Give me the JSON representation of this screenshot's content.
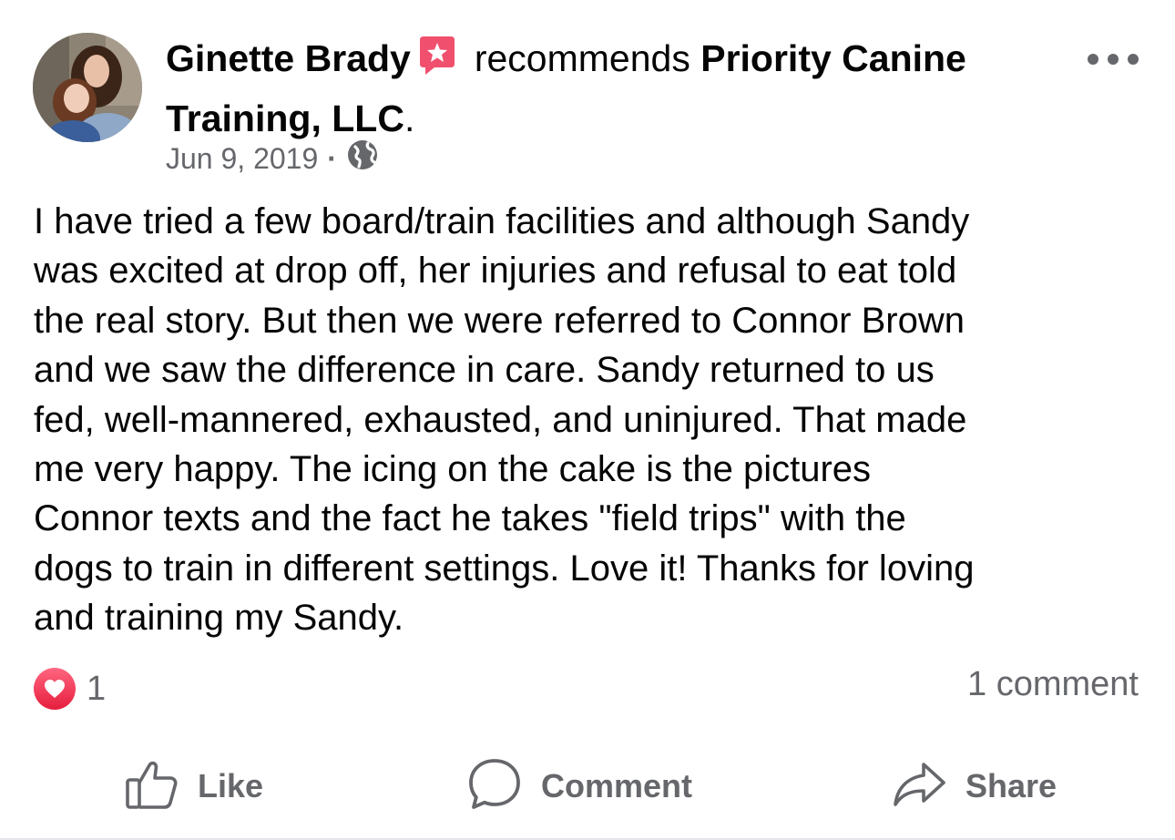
{
  "post": {
    "author": "Ginette Brady",
    "verb": "recommends",
    "page_name_line1": "Priority Canine",
    "page_name_line2": "Training, LLC",
    "page_name_period": ".",
    "date": "Jun 9, 2019",
    "separator": "·",
    "privacy_icon": "globe-icon",
    "badge_icon": "recommendation-star-icon",
    "more_icon": "ellipsis-icon",
    "text": "I have tried a few board/train facilities and although Sandy\nwas excited at drop off, her injuries and refusal to eat told\nthe real story. But then we were referred to Connor Brown\nand we saw the difference in care. Sandy returned to us\nfed, well-mannered, exhausted,  and uninjured. That made\nme very happy. The icing on the cake is the pictures\nConnor texts and the fact he takes \"field trips\" with the\ndogs to train in different settings. Love it! Thanks for loving\nand training my Sandy."
  },
  "stats": {
    "reaction_icon": "love-heart-icon",
    "reaction_count": "1",
    "comment_count": "1 comment"
  },
  "actions": {
    "like_label": "Like",
    "comment_label": "Comment",
    "share_label": "Share"
  },
  "colors": {
    "text_primary": "#050505",
    "text_secondary": "#65676b",
    "badge": "#f0506e",
    "heart": "#f33e58"
  }
}
